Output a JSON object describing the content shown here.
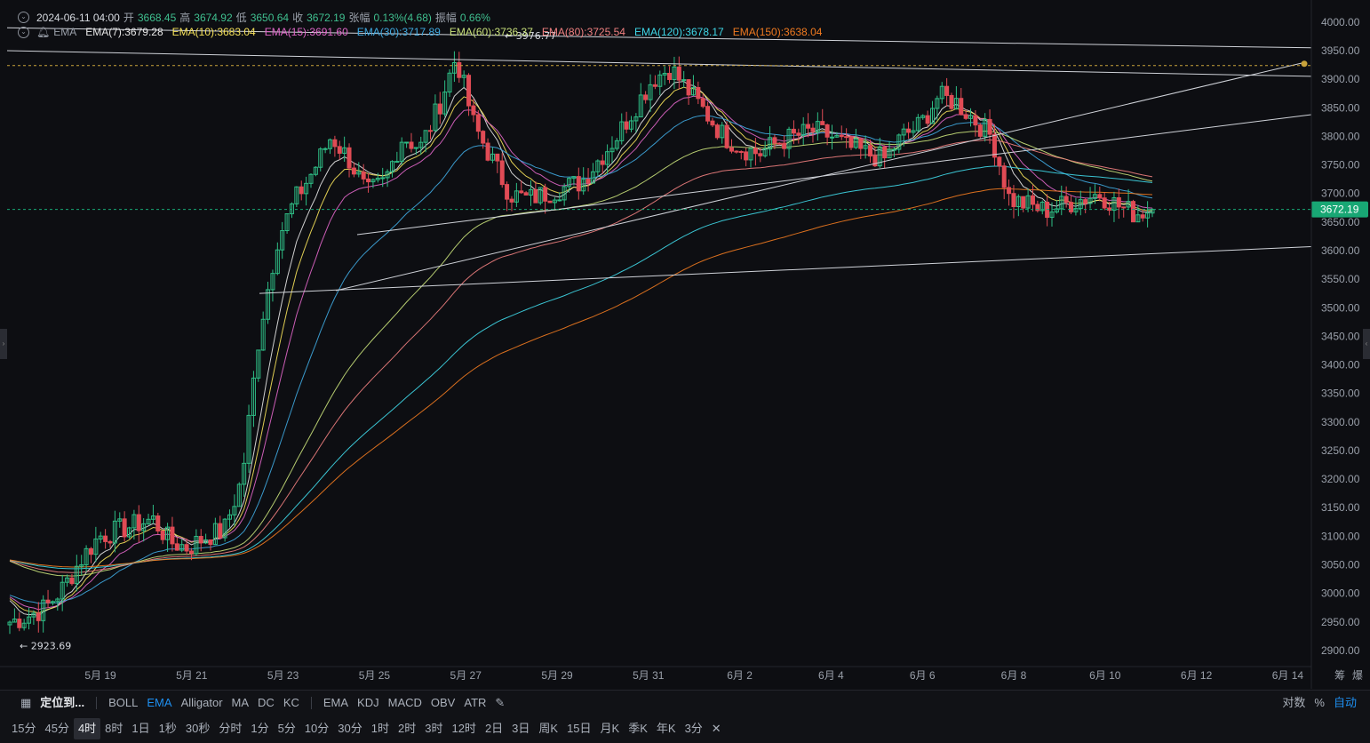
{
  "header": {
    "date": "2024-06-11 04:00",
    "open_label": "开",
    "open": "3668.45",
    "high_label": "高",
    "high": "3674.92",
    "low_label": "低",
    "low": "3650.64",
    "close_label": "收",
    "close": "3672.19",
    "change_label": "张幅",
    "change": "0.13%(4.68)",
    "amp_label": "振幅",
    "amp": "0.66%"
  },
  "indicator_name": "EMA",
  "emas": [
    {
      "label": "EMA(7):3679.28",
      "color": "#e6e6e6"
    },
    {
      "label": "EMA(10):3683.04",
      "color": "#f5e15a"
    },
    {
      "label": "EMA(15):3691.60",
      "color": "#e066c8"
    },
    {
      "label": "EMA(30):3717.89",
      "color": "#3fa9e0"
    },
    {
      "label": "EMA(60):3736.37",
      "color": "#c8e07a"
    },
    {
      "label": "EMA(80):3725.54",
      "color": "#f08080"
    },
    {
      "label": "EMA(120):3678.17",
      "color": "#3fd8e8"
    },
    {
      "label": "EMA(150):3638.04",
      "color": "#f07a20"
    }
  ],
  "annotations": {
    "high_marker": "3976.77",
    "low_marker": "← 2923.69"
  },
  "price_badge": "3672.19",
  "axis_corner": [
    "筹",
    "爆"
  ],
  "toolbar1": {
    "locate": "定位到...",
    "indicators": [
      "BOLL",
      "EMA",
      "Alligator",
      "MA",
      "DC",
      "KC"
    ],
    "indicators2": [
      "EMA",
      "KDJ",
      "MACD",
      "OBV",
      "ATR"
    ],
    "right": [
      "对数",
      "%",
      "自动"
    ]
  },
  "toolbar2": [
    "15分",
    "45分",
    "4时",
    "8时",
    "1日",
    "1秒",
    "30秒",
    "分时",
    "1分",
    "5分",
    "10分",
    "30分",
    "1时",
    "2时",
    "3时",
    "12时",
    "2日",
    "3日",
    "周K",
    "15日",
    "月K",
    "季K",
    "年K",
    "3分"
  ],
  "colors": {
    "up": "#2ebd85",
    "down": "#e04b55",
    "accent": "#1e8ff0",
    "badge": "#18a774"
  },
  "chart_data": {
    "type": "candlestick",
    "symbol_interval": "4时",
    "y_ticks": [
      4000,
      3950,
      3900,
      3850,
      3800,
      3750,
      3700,
      3650,
      3600,
      3550,
      3500,
      3450,
      3400,
      3350,
      3300,
      3250,
      3200,
      3150,
      3100,
      3050,
      3000,
      2950,
      2900
    ],
    "y_tick_labels": [
      "4000.00",
      "3950.00",
      "3900.00",
      "3850.00",
      "3800.00",
      "3750.00",
      "3700.00",
      "3650.00",
      "3600.00",
      "3550.00",
      "3500.00",
      "3450.00",
      "3400.00",
      "3350.00",
      "3300.00",
      "3250.00",
      "3200.00",
      "3150.00",
      "3100.00",
      "3050.00",
      "3000.00",
      "2950.00",
      "2900.00"
    ],
    "x_tick_labels": [
      "5月 19",
      "5月 21",
      "5月 23",
      "5月 25",
      "5月 27",
      "5月 29",
      "5月 31",
      "6月 2",
      "6月 4",
      "6月 6",
      "6月 8",
      "6月 10",
      "6月 12",
      "6月 14"
    ],
    "ylim": [
      2875,
      4020
    ],
    "last_price": 3672.19,
    "high": 3976.77,
    "low": 2923.69,
    "close_path": [
      2950,
      2960,
      2975,
      3010,
      3060,
      3100,
      3110,
      3120,
      3130,
      3090,
      3080,
      3100,
      3110,
      3200,
      3460,
      3620,
      3690,
      3740,
      3800,
      3760,
      3700,
      3720,
      3800,
      3780,
      3850,
      3940,
      3820,
      3760,
      3700,
      3690,
      3700,
      3710,
      3720,
      3760,
      3800,
      3850,
      3900,
      3920,
      3880,
      3840,
      3800,
      3780,
      3770,
      3790,
      3800,
      3810,
      3800,
      3780,
      3770,
      3760,
      3800,
      3820,
      3870,
      3860,
      3830,
      3800,
      3690,
      3680,
      3670,
      3680,
      3690,
      3700,
      3680,
      3665,
      3672
    ]
  }
}
